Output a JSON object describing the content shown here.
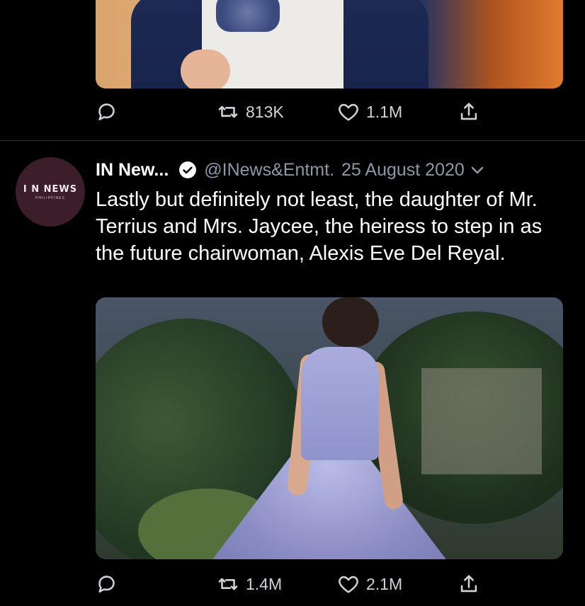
{
  "previous_tweet": {
    "actions": {
      "retweets": "813K",
      "likes": "1.1M"
    }
  },
  "tweet": {
    "avatar_text": "I N NEWS",
    "avatar_subtext": "PHILIPPINES",
    "display_name": "IN New...",
    "handle": "@INews&Entmt.",
    "date": "25 August 2020",
    "text": "Lastly but definitely not least, the daughter of Mr. Terrius and Mrs. Jaycee, the heiress to step in as the future chairwoman, Alexis Eve Del Reyal.",
    "actions": {
      "retweets": "1.4M",
      "likes": "2.1M"
    }
  },
  "colors": {
    "background": "#000000",
    "secondary_text": "#8b98a5",
    "divider": "#2f3336"
  }
}
